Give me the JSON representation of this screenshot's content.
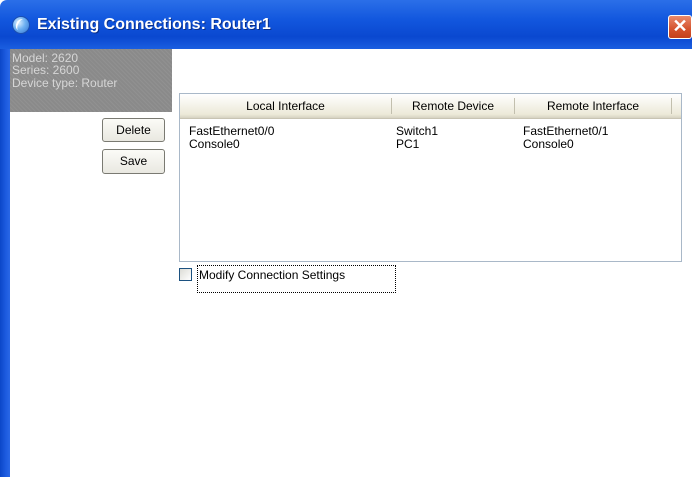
{
  "window": {
    "title": "Existing Connections: Router1",
    "close_glyph": "✕"
  },
  "device_info": {
    "model": "Model: 2620",
    "series": "Series: 2600",
    "device_type": "Device type: Router"
  },
  "buttons": {
    "delete_label": "Delete",
    "save_label": "Save"
  },
  "connections_table": {
    "columns": [
      "Local Interface",
      "Remote Device",
      "Remote Interface"
    ],
    "rows": [
      [
        "FastEthernet0/0",
        "Switch1",
        "FastEthernet0/1"
      ],
      [
        "Console0",
        "PC1",
        "Console0"
      ]
    ]
  },
  "modify_settings": {
    "label": "Modify Connection Settings",
    "checked": false
  },
  "colors": {
    "titlebar": "#0a48d0",
    "info_panel": "#8a8a8a",
    "close_button": "#d4522c"
  },
  "icons": {
    "app": "app-swirl-icon",
    "close": "close-icon"
  }
}
